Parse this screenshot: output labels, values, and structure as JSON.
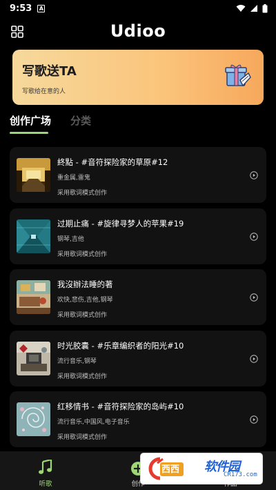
{
  "status_bar": {
    "time": "9:53",
    "notification_letter": "A"
  },
  "header": {
    "title": "Udioo",
    "menu_icon": "grid-icon"
  },
  "banner": {
    "title": "写歌送TA",
    "subtitle": "写歌给在意的人",
    "icon": "gift-icon"
  },
  "tabs": [
    {
      "label": "创作广场",
      "active": true
    },
    {
      "label": "分类",
      "active": false
    }
  ],
  "songs": [
    {
      "title": "終點 - #音符探险家的草原#12",
      "tags": "重金属,雷鬼",
      "mode": "采用歌词模式创作",
      "thumb": "station-art"
    },
    {
      "title": "过期止痛 - #旋律寻梦人的苹果#19",
      "tags": "钢琴,吉他",
      "mode": "采用歌词模式创作",
      "thumb": "tunnel-art"
    },
    {
      "title": "我沒辦法睡的著",
      "tags": "欢快,悲伤,吉他,钢琴",
      "mode": "采用歌词模式创作",
      "thumb": "room-art"
    },
    {
      "title": "时光胶囊 - #乐章编织者的阳光#10",
      "tags": "流行音乐,钢琴",
      "mode": "采用歌词模式创作",
      "thumb": "collage-art"
    },
    {
      "title": "红移情书 - #音符探险家的岛屿#10",
      "tags": "流行音乐,中国风,电子音乐",
      "mode": "采用歌词模式创作",
      "thumb": "spiral-art"
    }
  ],
  "bottom_nav": [
    {
      "label": "听歌",
      "icon": "music-note-icon",
      "active": true
    },
    {
      "label": "创作",
      "icon": "plus-icon",
      "active": false
    },
    {
      "label": "作品",
      "icon": "works-icon",
      "active": false
    }
  ],
  "watermark": {
    "brand": "软件园",
    "url": "CR173.com",
    "logo_text": "西西"
  },
  "colors": {
    "accent": "#9ed676",
    "background": "#000000",
    "card": "#121212",
    "banner_start": "#f6d99c",
    "banner_end": "#f6a85c"
  }
}
